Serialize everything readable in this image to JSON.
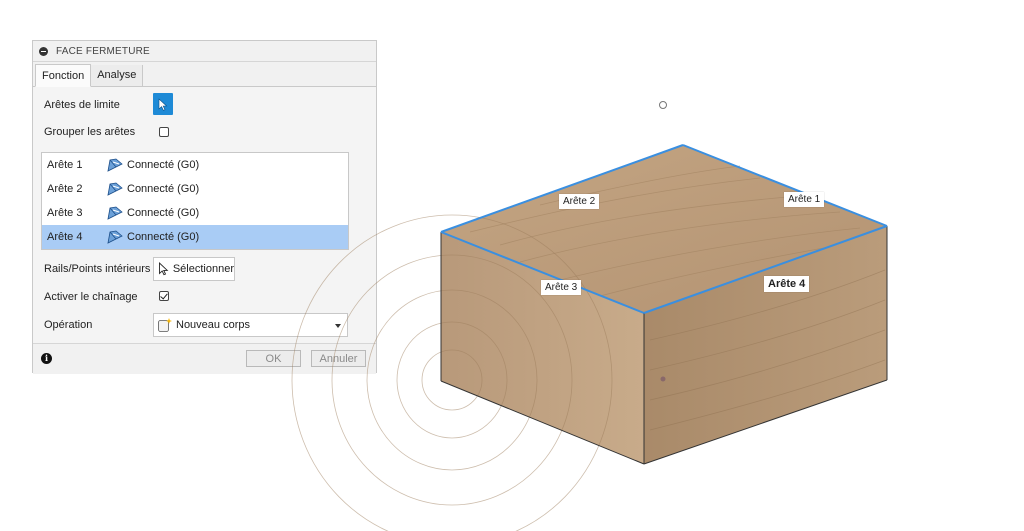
{
  "dialog": {
    "title": "FACE FERMETURE",
    "tabs": [
      {
        "label": "Fonction",
        "active": true
      },
      {
        "label": "Analyse",
        "active": false
      }
    ],
    "boundary_edges_label": "Arêtes de limite",
    "group_edges_label": "Grouper les arêtes",
    "group_edges_checked": false,
    "edges": [
      {
        "name": "Arête 1",
        "status": "Connecté (G0)",
        "selected": false
      },
      {
        "name": "Arête 2",
        "status": "Connecté (G0)",
        "selected": false
      },
      {
        "name": "Arête 3",
        "status": "Connecté (G0)",
        "selected": false
      },
      {
        "name": "Arête 4",
        "status": "Connecté (G0)",
        "selected": true
      }
    ],
    "rails_label": "Rails/Points intérieurs",
    "select_button": "Sélectionner",
    "chaining_label": "Activer le chaînage",
    "chaining_checked": true,
    "operation_label": "Opération",
    "operation_value": "Nouveau corps",
    "ok_label": "OK",
    "cancel_label": "Annuler"
  },
  "viewport": {
    "edge_labels": [
      {
        "text": "Arête 1",
        "bold": false
      },
      {
        "text": "Arête 2",
        "bold": false
      },
      {
        "text": "Arête 3",
        "bold": false
      },
      {
        "text": "Arête 4",
        "bold": true
      }
    ],
    "highlight_color": "#3a8fe0"
  }
}
